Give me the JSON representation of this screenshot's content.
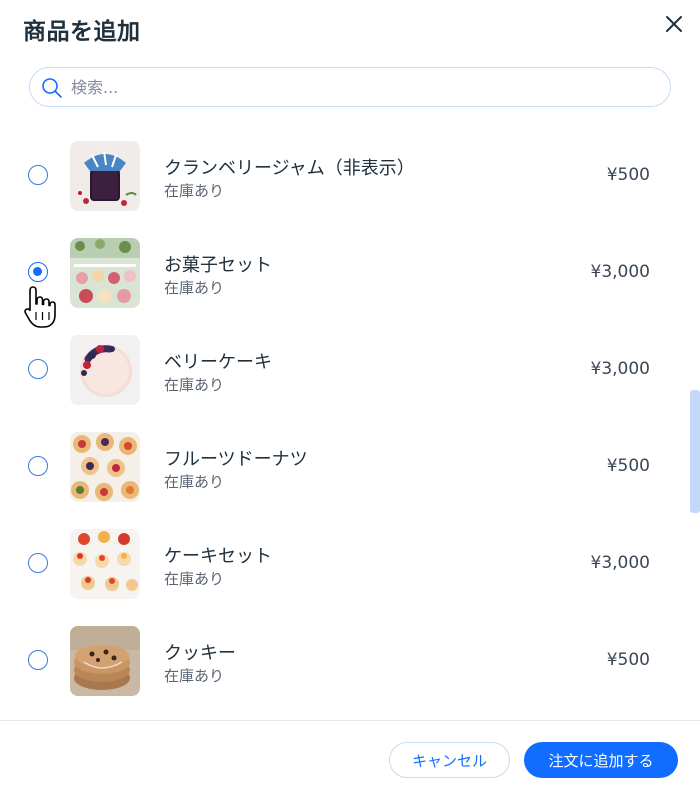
{
  "dialog": {
    "title": "商品を追加"
  },
  "search": {
    "placeholder": "検索..."
  },
  "products": [
    {
      "name": "クランベリージャム（非表示）",
      "stock": "在庫あり",
      "price": "¥500",
      "selected": false
    },
    {
      "name": "お菓子セット",
      "stock": "在庫あり",
      "price": "¥3,000",
      "selected": true
    },
    {
      "name": "ベリーケーキ",
      "stock": "在庫あり",
      "price": "¥3,000",
      "selected": false
    },
    {
      "name": "フルーツドーナツ",
      "stock": "在庫あり",
      "price": "¥500",
      "selected": false
    },
    {
      "name": "ケーキセット",
      "stock": "在庫あり",
      "price": "¥3,000",
      "selected": false
    },
    {
      "name": "クッキー",
      "stock": "在庫あり",
      "price": "¥500",
      "selected": false
    }
  ],
  "footer": {
    "cancel_label": "キャンセル",
    "add_label": "注文に追加する"
  },
  "colors": {
    "accent": "#116dff",
    "text": "#20303c",
    "border": "#c9dbf0"
  }
}
